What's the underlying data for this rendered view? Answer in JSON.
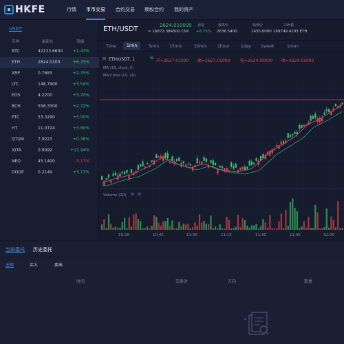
{
  "nav": {
    "brand": "HKFE",
    "items": [
      "行情",
      "币币交易",
      "合约交易",
      "期权合约",
      "我的资产"
    ],
    "active": 1
  },
  "market": {
    "tab": "USDT",
    "headers": [
      "币种",
      "最新价",
      "涨幅"
    ],
    "rows": [
      {
        "coin": "BTC",
        "price": "42133.6600",
        "change": "+1.43%",
        "dir": "up"
      },
      {
        "coin": "ETH",
        "price": "2624.0100",
        "change": "+6.75%",
        "dir": "up"
      },
      {
        "coin": "XRP",
        "price": "0.7683",
        "change": "+2.75%",
        "dir": "up"
      },
      {
        "coin": "LTC",
        "price": "148.7900",
        "change": "+3.54%",
        "dir": "up"
      },
      {
        "coin": "EOS",
        "price": "4.2200",
        "change": "+3.70%",
        "dir": "up"
      },
      {
        "coin": "BCH",
        "price": "558.3300",
        "change": "+2.72%",
        "dir": "up"
      },
      {
        "coin": "ETC",
        "price": "53.3290",
        "change": "+5.00%",
        "dir": "up"
      },
      {
        "coin": "HT",
        "price": "11.0724",
        "change": "+3.60%",
        "dir": "up"
      },
      {
        "coin": "QTUM",
        "price": "7.9223",
        "change": "+0.36%",
        "dir": "up"
      },
      {
        "coin": "IOTA",
        "price": "0.9092",
        "change": "+11.94%",
        "dir": "up"
      },
      {
        "coin": "NEO",
        "price": "45.1400",
        "change": "-3.17%",
        "dir": "down"
      },
      {
        "coin": "DOGE",
        "price": "0.2149",
        "change": "+3.71%",
        "dir": "up"
      }
    ]
  },
  "ticker": {
    "pair": "ETH/USDT",
    "last_price": "2624.010000",
    "cny": "≈ 16872.384300 CNY",
    "change_label": "涨幅",
    "change": "+6.75%",
    "high_label": "最高价",
    "high": "2636.5400",
    "low_label": "最低价",
    "low": "2435.0000",
    "volume_label": "24H量",
    "volume": "169749.4193 ETH"
  },
  "timeframes": [
    "Time",
    "1min",
    "5min",
    "15min",
    "30min",
    "1hour",
    "1day",
    "1week",
    "1mon"
  ],
  "active_timeframe": 1,
  "chart_info": {
    "symbol": "ETH/USDT, 1",
    "open": "开=2627.01000",
    "high": "高=2627.01000",
    "low": "低=2624.00000",
    "close": "收=2624.01000",
    "ma1": "MA (15, close, 0)",
    "ma2": "MA Cross (10, 20)",
    "volume": "Volume (20)"
  },
  "x_labels": [
    "10:30",
    "10:45",
    "11:00",
    "11:15",
    "11:30",
    "11:45",
    "12:00"
  ],
  "orders": {
    "tabs": [
      "当前委托",
      "历史委托"
    ],
    "filters": [
      "全部",
      "买入",
      "卖出"
    ],
    "columns": [
      "时间",
      "交易对",
      "方向",
      "数量"
    ]
  },
  "colors": {
    "up": "#3cc66b",
    "down": "#e0474c",
    "accent": "#4a90e2"
  }
}
